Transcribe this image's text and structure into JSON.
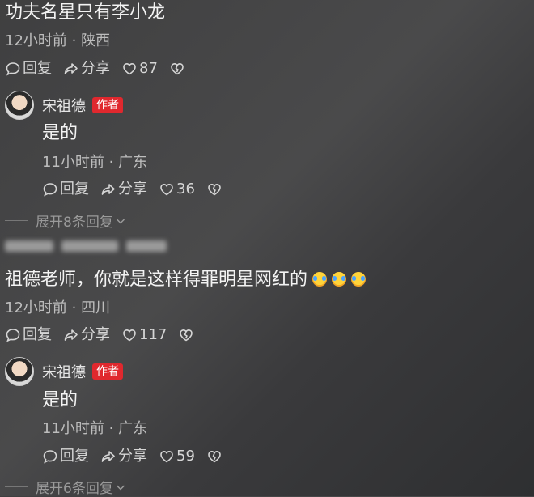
{
  "comments": [
    {
      "text": "功夫名星只有李小龙",
      "meta": "12小时前 · 陕西",
      "reply_label": "回复",
      "share_label": "分享",
      "likes": "87"
    },
    {
      "text": "祖德老师，你就是这样得罪明星网红的",
      "meta": "12小时前 · 四川",
      "reply_label": "回复",
      "share_label": "分享",
      "likes": "117"
    }
  ],
  "replies": [
    {
      "author": "宋祖德",
      "badge": "作者",
      "text": "是的",
      "meta": "11小时前 · 广东",
      "reply_label": "回复",
      "share_label": "分享",
      "likes": "36",
      "expand": "展开8条回复"
    },
    {
      "author": "宋祖德",
      "badge": "作者",
      "text": "是的",
      "meta": "11小时前 · 广东",
      "reply_label": "回复",
      "share_label": "分享",
      "likes": "59",
      "expand": "展开6条回复"
    }
  ],
  "icons": {
    "reply": "comment-bubble-icon",
    "share": "share-arrow-icon",
    "like": "heart-icon",
    "dislike": "broken-heart-icon",
    "expand": "chevron-down-icon",
    "emoji": "laughing-tears-emoji"
  },
  "colors": {
    "author_badge": "#e0282e",
    "background": "#434344"
  }
}
